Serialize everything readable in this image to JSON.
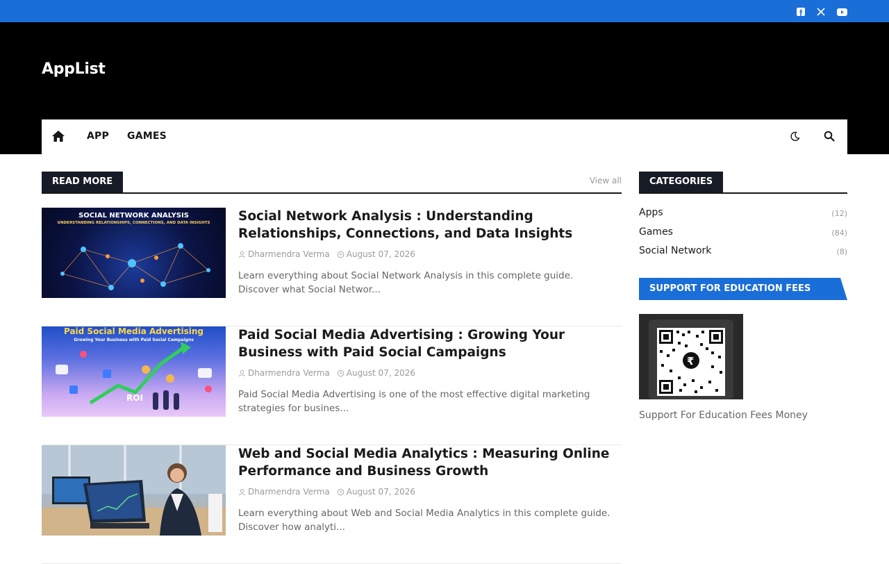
{
  "site": {
    "logo": "AppList"
  },
  "social": [
    {
      "name": "facebook-icon"
    },
    {
      "name": "x-icon"
    },
    {
      "name": "youtube-icon"
    }
  ],
  "nav": {
    "items": [
      "APP",
      "GAMES"
    ]
  },
  "colors": {
    "accent": "#1a6ed8",
    "dark": "#171b26"
  },
  "main": {
    "section_title": "READ MORE",
    "view_all": "View all",
    "posts": [
      {
        "title": "Social Network Analysis : Understanding Relationships, Connections, and Data Insights",
        "author": "Dharmendra Verma",
        "date": "August 07, 2026",
        "excerpt": "Learn everything about Social Network Analysis in this complete guide. Discover what Social Networ...",
        "thumb_text": "SOCIAL NETWORK ANALYSIS",
        "thumb_sub": "UNDERSTANDING RELATIONSHIPS, CONNECTIONS, AND DATA INSIGHTS"
      },
      {
        "title": "Paid Social Media Advertising : Growing Your Business with Paid Social Campaigns",
        "author": "Dharmendra Verma",
        "date": "August 07, 2026",
        "excerpt": "Paid Social Media Advertising is one of the most effective digital marketing strategies for busines...",
        "thumb_text": "Paid Social Media Advertising",
        "thumb_sub": "Growing Your Business with Paid Social Campaigns"
      },
      {
        "title": "Web and Social Media Analytics : Measuring Online Performance and Business Growth",
        "author": "Dharmendra Verma",
        "date": "August 07, 2026",
        "excerpt": "Learn everything about Web and Social Media Analytics in this complete guide. Discover how analyti...",
        "thumb_text": "",
        "thumb_sub": ""
      }
    ]
  },
  "sidebar": {
    "categories_title": "CATEGORIES",
    "categories": [
      {
        "label": "Apps",
        "count": "(12)"
      },
      {
        "label": "Games",
        "count": "(84)"
      },
      {
        "label": "Social Network",
        "count": "(8)"
      }
    ],
    "support_title": "SUPPORT FOR EDUCATION FEES MONEY",
    "support_caption": "Support For Education Fees Money"
  }
}
